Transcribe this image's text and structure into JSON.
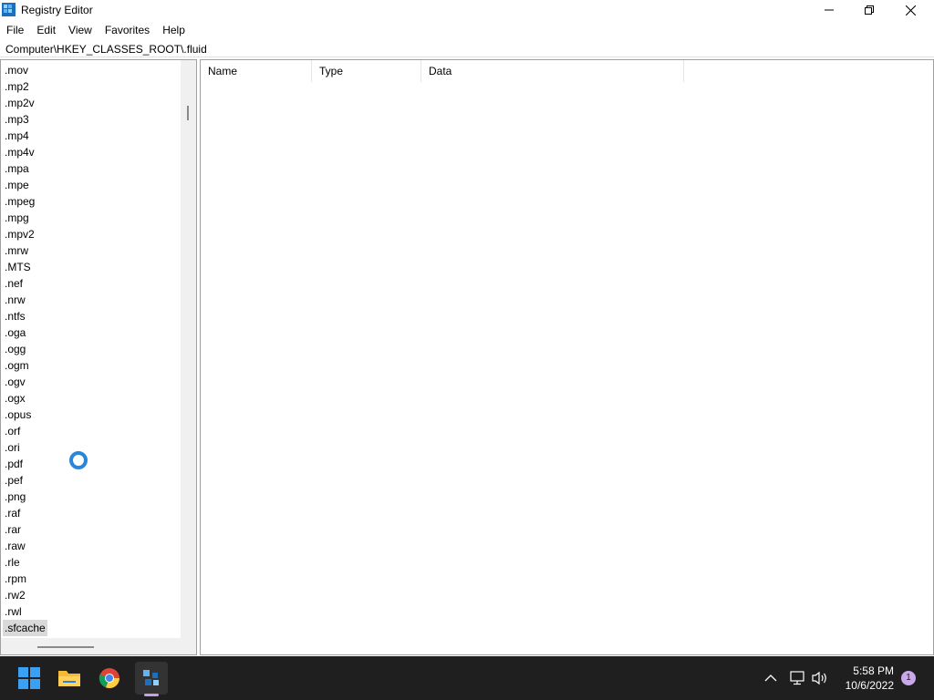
{
  "window": {
    "title": "Registry Editor"
  },
  "menu": [
    "File",
    "Edit",
    "View",
    "Favorites",
    "Help"
  ],
  "address": "Computer\\HKEY_CLASSES_ROOT\\.fluid",
  "tree": {
    "items": [
      ".mov",
      ".mp2",
      ".mp2v",
      ".mp3",
      ".mp4",
      ".mp4v",
      ".mpa",
      ".mpe",
      ".mpeg",
      ".mpg",
      ".mpv2",
      ".mrw",
      ".MTS",
      ".nef",
      ".nrw",
      ".ntfs",
      ".oga",
      ".ogg",
      ".ogm",
      ".ogv",
      ".ogx",
      ".opus",
      ".orf",
      ".ori",
      ".pdf",
      ".pef",
      ".png",
      ".raf",
      ".rar",
      ".raw",
      ".rle",
      ".rpm",
      ".rw2",
      ".rwl",
      ".sfcache"
    ],
    "selected_index": 34
  },
  "columns": [
    "Name",
    "Type",
    "Data"
  ],
  "taskbar": {
    "time": "5:58 PM",
    "date": "10/6/2022",
    "notification_count": "1"
  },
  "colors": {
    "taskbar_bg": "#1f1f1f",
    "accent": "#2a86d8",
    "selection": "#d9d9d9"
  }
}
